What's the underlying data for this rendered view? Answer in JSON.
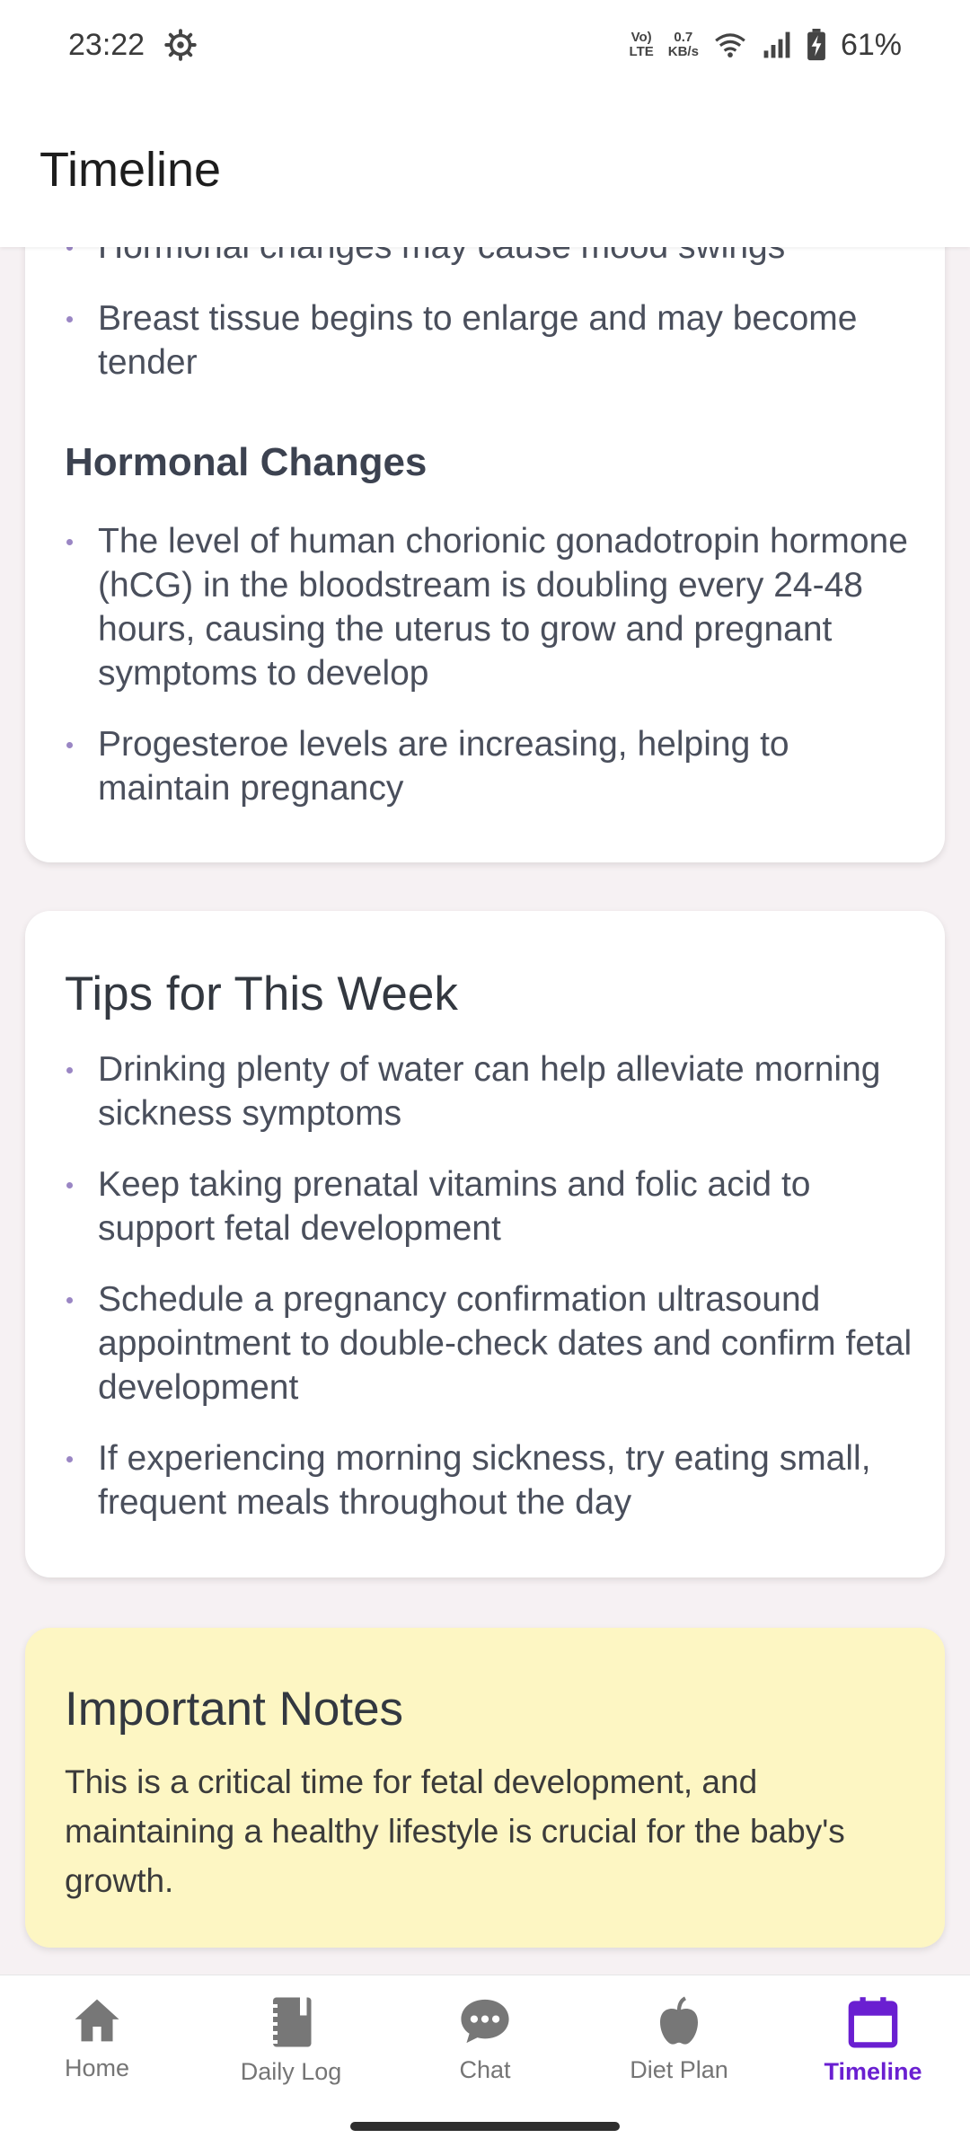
{
  "status_bar": {
    "time": "23:22",
    "network_top": "Vo)",
    "network_bottom": "LTE",
    "speed_value": "0.7",
    "speed_unit": "KB/s",
    "battery": "61%"
  },
  "header": {
    "title": "Timeline"
  },
  "changes_card": {
    "partial_bullet": "Hormonal changes may cause mood swings",
    "bullets_top": [
      "Breast tissue begins to enlarge and may become tender"
    ],
    "section_title": "Hormonal Changes",
    "hormonal_bullets": [
      "The level of human chorionic gonadotropin hormone (hCG) in the bloodstream is doubling every 24-48 hours, causing the uterus to grow and pregnant symptoms to develop",
      "Progesteroe levels are increasing, helping to maintain pregnancy"
    ]
  },
  "tips_card": {
    "title": "Tips for This Week",
    "bullets": [
      "Drinking plenty of water can help alleviate morning sickness symptoms",
      "Keep taking prenatal vitamins and folic acid to support fetal development",
      "Schedule a pregnancy confirmation ultrasound appointment to double-check dates and confirm fetal development",
      "If experiencing morning sickness, try eating small, frequent meals throughout the day"
    ]
  },
  "notes_card": {
    "title": "Important Notes",
    "text": "This is a critical time for fetal development, and maintaining a healthy lifestyle is crucial for the baby's growth."
  },
  "bottom_nav": {
    "items": [
      {
        "label": "Home",
        "icon": "home-icon"
      },
      {
        "label": "Daily Log",
        "icon": "notebook-icon"
      },
      {
        "label": "Chat",
        "icon": "chat-icon"
      },
      {
        "label": "Diet Plan",
        "icon": "apple-icon"
      },
      {
        "label": "Timeline",
        "icon": "calendar-icon"
      }
    ],
    "active": "Timeline"
  },
  "colors": {
    "accent": "#6a1fd1",
    "bullet": "#9a86c4",
    "notes_background": "#fdf6c3",
    "page_background": "#f6f1f3"
  }
}
